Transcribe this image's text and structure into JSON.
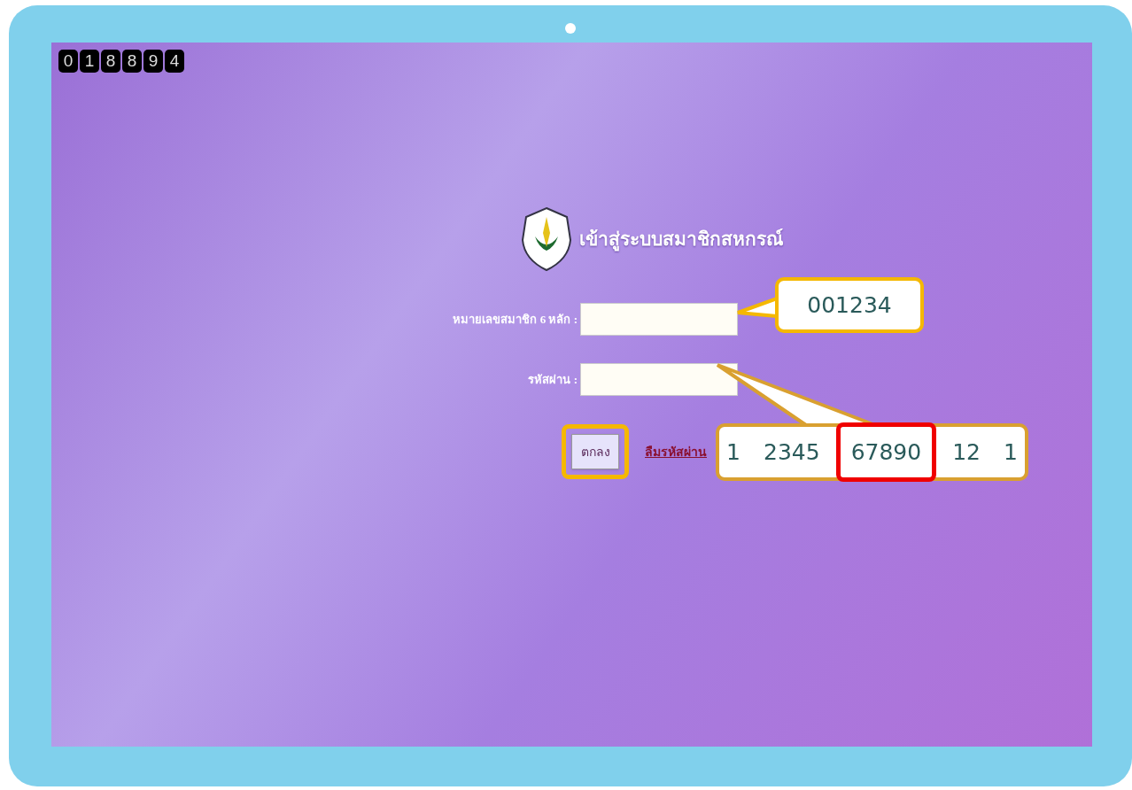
{
  "visit_counter": [
    "0",
    "1",
    "8",
    "8",
    "9",
    "4"
  ],
  "login": {
    "title": "เข้าสู่ระบบสมาชิกสหกรณ์",
    "fields": [
      {
        "label": "หมายเลขสมาชิก 6 หลัก :"
      },
      {
        "label": "รหัสผ่าน :"
      }
    ],
    "submit": {
      "label": "ตกลง",
      "highlighted": true
    },
    "forgot_link": "ลืมรหัสผ่าน"
  },
  "callouts": [
    {
      "kind": "member",
      "segments": [
        {
          "text": "001234",
          "highlighted": false
        }
      ]
    },
    {
      "kind": "password",
      "segments": [
        {
          "text": "1",
          "highlighted": false
        },
        {
          "text": "2345",
          "highlighted": false
        },
        {
          "text": "67890",
          "highlighted": true
        },
        {
          "text": "12",
          "highlighted": false
        },
        {
          "text": "1",
          "highlighted": false
        }
      ]
    }
  ]
}
